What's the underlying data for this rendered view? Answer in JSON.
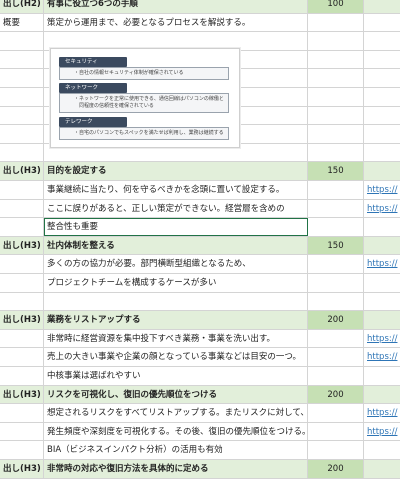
{
  "rows": [
    {
      "kind": "hdr",
      "c0": "出し(H2)",
      "c1": "有事に役立つ6つの手順",
      "c2": "100",
      "c3": ""
    },
    {
      "kind": "txt",
      "c0": "概要",
      "c1": "策定から運用まで、必要となるプロセスを解説する。",
      "c2": "",
      "c3": ""
    },
    {
      "kind": "blank"
    },
    {
      "kind": "blank"
    },
    {
      "kind": "blank"
    },
    {
      "kind": "blank"
    },
    {
      "kind": "blank"
    },
    {
      "kind": "blank"
    },
    {
      "kind": "blank"
    },
    {
      "kind": "hdr",
      "c0": "出し(H3)",
      "c1": "目的を設定する",
      "c2": "150",
      "c3": ""
    },
    {
      "kind": "txt",
      "c0": "",
      "c1": "事業継続に当たり、何を守るべきかを念頭に置いて設定する。",
      "c2": "",
      "c3": "https://"
    },
    {
      "kind": "txt",
      "c0": "",
      "c1": "ここに誤りがあると、正しい策定ができない。経営層を含めの",
      "c2": "",
      "c3": "https://"
    },
    {
      "kind": "sel",
      "c0": "",
      "c1": "整合性も重要",
      "c2": "",
      "c3": ""
    },
    {
      "kind": "hdr",
      "c0": "出し(H3)",
      "c1": "社内体制を整える",
      "c2": "150",
      "c3": ""
    },
    {
      "kind": "txt",
      "c0": "",
      "c1": "多くの方の協力が必要。部門横断型組織となるため、",
      "c2": "",
      "c3": "https://"
    },
    {
      "kind": "txt",
      "c0": "",
      "c1": "プロジェクトチームを構成するケースが多い",
      "c2": "",
      "c3": ""
    },
    {
      "kind": "blank"
    },
    {
      "kind": "hdr",
      "c0": "出し(H3)",
      "c1": "業務をリストアップする",
      "c2": "200",
      "c3": ""
    },
    {
      "kind": "txt",
      "c0": "",
      "c1": "非常時に経営資源を集中投下すべき業務・事業を洗い出す。",
      "c2": "",
      "c3": "https://"
    },
    {
      "kind": "txt",
      "c0": "",
      "c1": "売上の大きい事業や企業の顔となっている事業などは目安の一つ。",
      "c2": "",
      "c3": "https://"
    },
    {
      "kind": "txt",
      "c0": "",
      "c1": "中核事業は選ばれやすい",
      "c2": "",
      "c3": ""
    },
    {
      "kind": "hdr",
      "c0": "出し(H3)",
      "c1": "リスクを可視化し、復旧の優先順位をつける",
      "c2": "200",
      "c3": ""
    },
    {
      "kind": "txt",
      "c0": "",
      "c1": "想定されるリスクをすべてリストアップする。またリスクに対して、",
      "c2": "",
      "c3": "https://"
    },
    {
      "kind": "txt",
      "c0": "",
      "c1": "発生頻度や深刻度を可視化する。その後、復旧の優先順位をつける。",
      "c2": "",
      "c3": "https://"
    },
    {
      "kind": "txt",
      "c0": "",
      "c1": "BIA（ビジネスインパクト分析）の活用も有効",
      "c2": "",
      "c3": ""
    },
    {
      "kind": "hdr",
      "c0": "出し(H3)",
      "c1": "非常時の対応や復旧方法を具体的に定める",
      "c2": "200",
      "c3": ""
    }
  ],
  "diagram": {
    "boxes": [
      {
        "tag": "セキュリティ",
        "lines": [
          "・自社の情報セキュリティ体制が確保されている"
        ]
      },
      {
        "tag": "ネットワーク",
        "lines": [
          "・ネットワークを正常に使用できる、通信回線はパソコンの稼働と",
          "　同程度の信頼性を確保されている"
        ]
      },
      {
        "tag": "テレワーク",
        "lines": [
          "・自宅のパソコンでもスペックを満たせば利用し、業務は継続する"
        ]
      }
    ]
  }
}
